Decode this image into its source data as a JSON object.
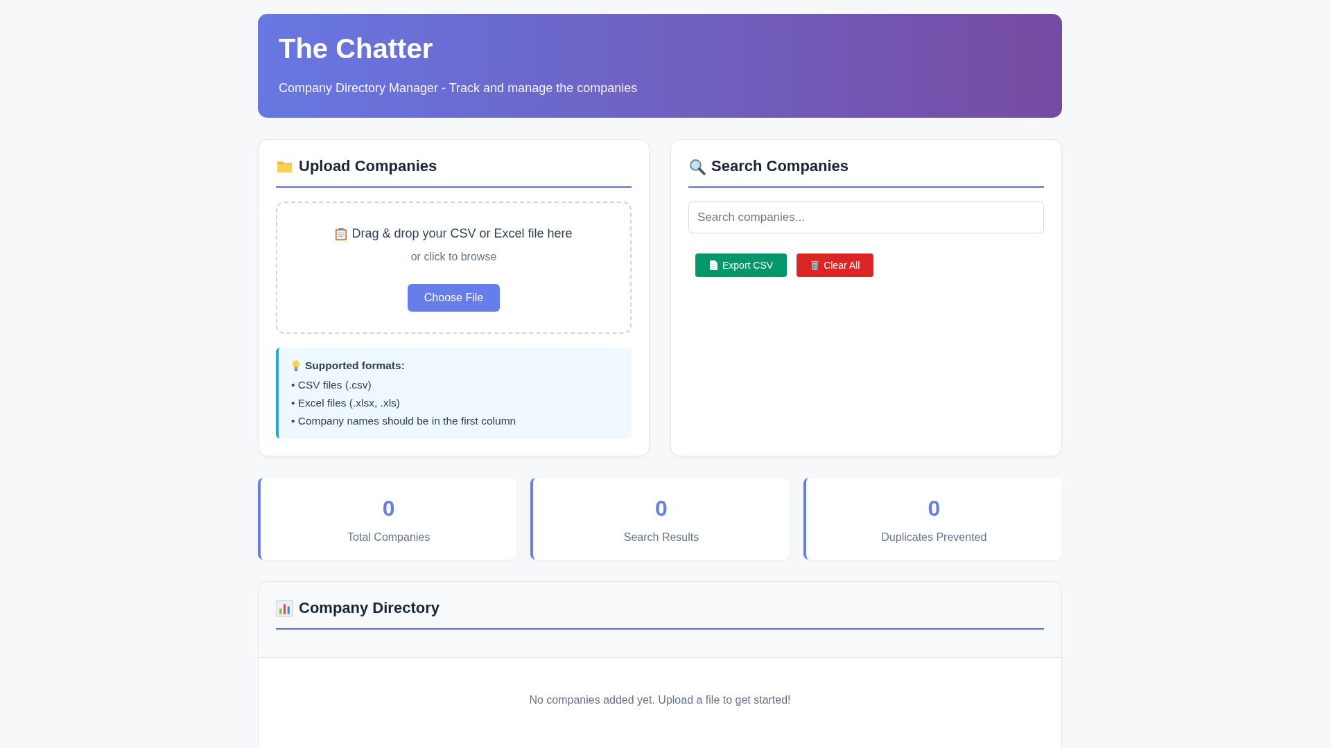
{
  "header": {
    "title": "The Chatter",
    "subtitle": "Company Directory Manager - Track and manage the companies"
  },
  "upload": {
    "heading": "Upload Companies",
    "drop_text": "Drag & drop your CSV or Excel file here",
    "browse_text": "or click to browse",
    "button": "Choose File",
    "formats": {
      "heading": "Supported formats:",
      "items": [
        "• CSV files (.csv)",
        "• Excel files (.xlsx, .xls)",
        "• Company names should be in the first column"
      ]
    }
  },
  "search": {
    "heading": "Search Companies",
    "placeholder": "Search companies...",
    "buttons": [
      {
        "label": "Export CSV",
        "kind": "export"
      },
      {
        "label": "Clear All",
        "kind": "clear"
      }
    ]
  },
  "stats": [
    {
      "value": "0",
      "label": "Total Companies"
    },
    {
      "value": "0",
      "label": "Search Results"
    },
    {
      "value": "0",
      "label": "Duplicates Prevented"
    }
  ],
  "directory": {
    "heading": "Company Directory",
    "empty_message": "No companies added yet. Upload a file to get started!"
  }
}
